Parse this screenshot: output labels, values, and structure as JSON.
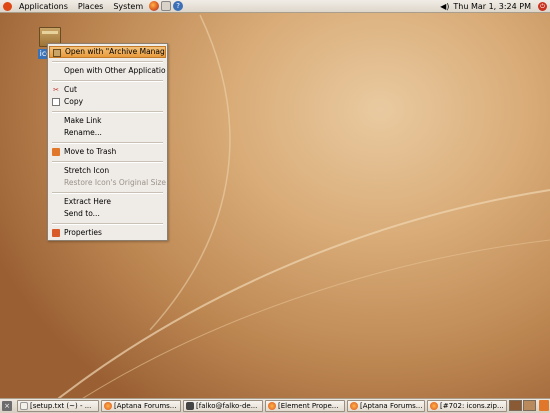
{
  "top_panel": {
    "menus": [
      "Applications",
      "Places",
      "System"
    ],
    "clock": "Thu Mar  1,  3:24 PM"
  },
  "desktop_icon": {
    "label": "icons"
  },
  "context_menu": {
    "items": [
      "Open with \"Archive Manager\"",
      "Open with Other Application...",
      "Cut",
      "Copy",
      "Make Link",
      "Rename...",
      "Move to Trash",
      "Stretch Icon",
      "Restore Icon's Original Size",
      "Extract Here",
      "Send to...",
      "Properties"
    ]
  },
  "taskbar": {
    "tasks": [
      "[setup.txt (~) - ...",
      "[Aptana Forums...",
      "[falko@falko-de...",
      "[Element Prope...",
      "[Aptana Forums...",
      "[#702: icons.zip..."
    ]
  },
  "colors": {
    "menu_highlight": "#e89a3b",
    "desktop": "#c08a57",
    "selection": "#3a72b8"
  }
}
